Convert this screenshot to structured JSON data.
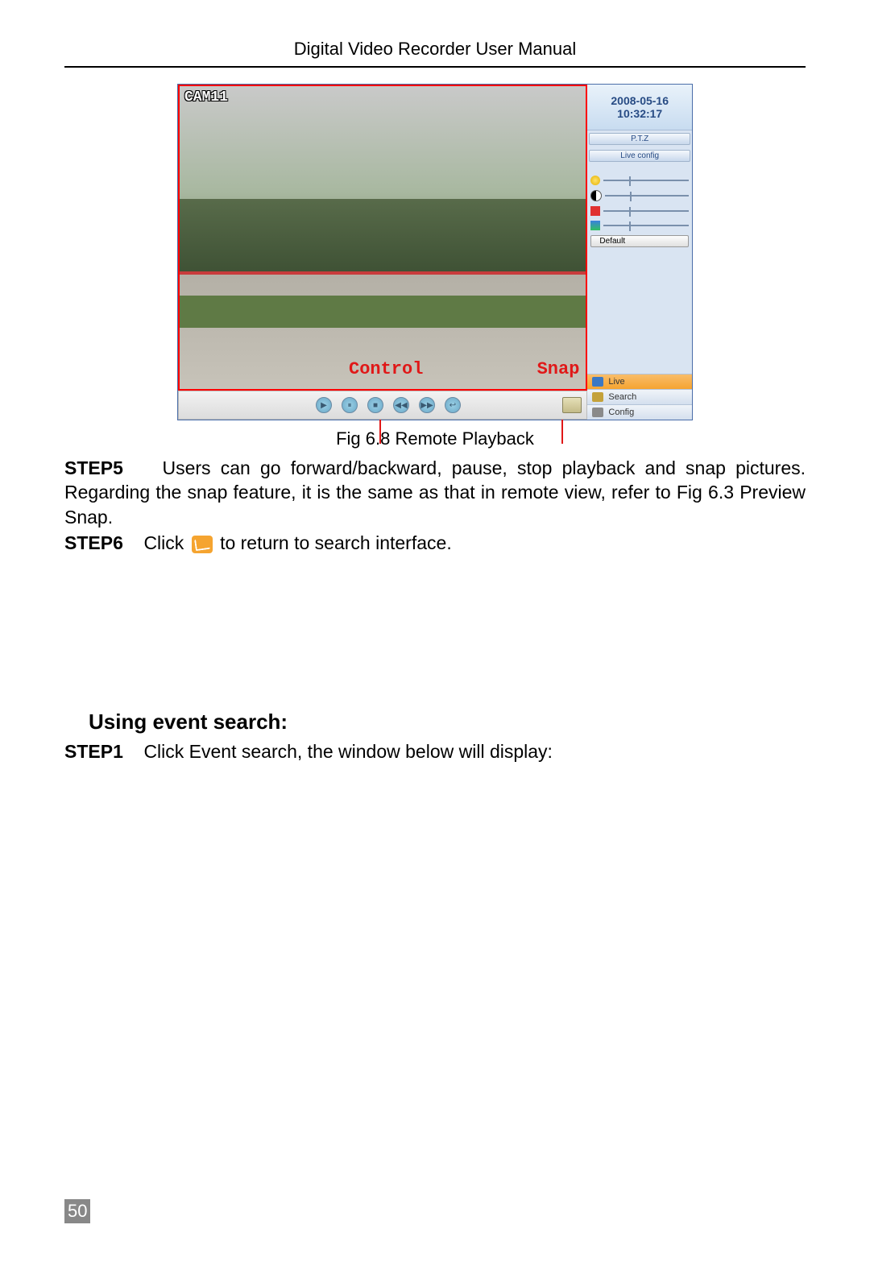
{
  "header": {
    "title": "Digital Video Recorder User Manual"
  },
  "figure": {
    "caption": "Fig 6.8    Remote Playback",
    "camera_label": "CAM11",
    "overlay_control": "Control",
    "overlay_snap": "Snap",
    "datetime": {
      "date": "2008-05-16",
      "time": "10:32:17"
    },
    "tabs": {
      "ptz": "P.T.Z",
      "live_config": "Live config"
    },
    "default_btn": "Default",
    "sliders": [
      {
        "name": "brightness"
      },
      {
        "name": "contrast"
      },
      {
        "name": "saturation"
      },
      {
        "name": "hue"
      }
    ],
    "toolbar_buttons": [
      "play",
      "pause",
      "stop",
      "rewind",
      "forward",
      "return"
    ],
    "nav": {
      "live": "Live",
      "search": "Search",
      "config": "Config"
    }
  },
  "steps": {
    "s5_label": "STEP5",
    "s5_text": "Users  can  go  forward/backward,  pause,  stop  playback  and  snap pictures. Regarding the snap feature, it is the same as that in remote view, refer to Fig 6.3 Preview Snap.",
    "s6_label": "STEP6",
    "s6_pre": "Click",
    "s6_post": " to return to search interface.",
    "section_title": "Using event search:",
    "s1_label": "STEP1",
    "s1_text": "Click Event search, the window below will display:"
  },
  "page_number": "50"
}
